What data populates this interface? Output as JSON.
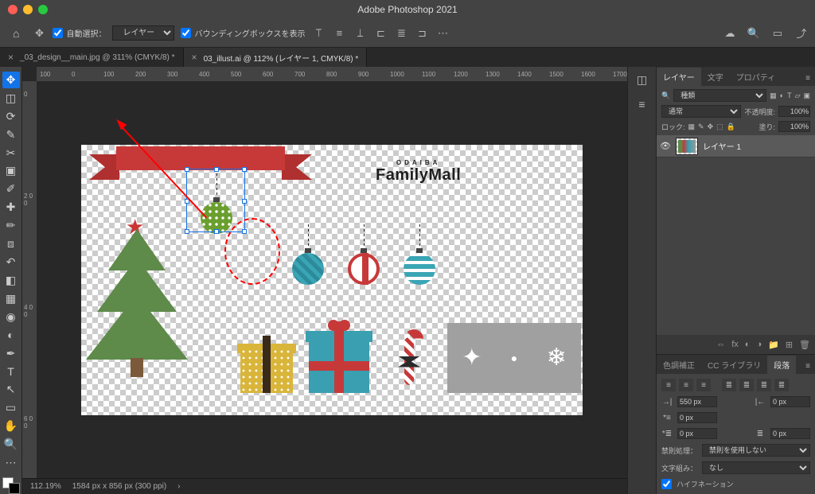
{
  "app_title": "Adobe Photoshop 2021",
  "options": {
    "auto_select_label": "自動選択：",
    "auto_select_value": "レイヤー",
    "bounding_label": "バウンディングボックスを表示"
  },
  "tabs": [
    {
      "label": "_03_design__main.jpg @ 311% (CMYK/8) *",
      "active": false
    },
    {
      "label": "03_illust.ai @ 112% (レイヤー 1, CMYK/8) *",
      "active": true
    }
  ],
  "ruler_h": [
    "100",
    "0",
    "100",
    "200",
    "300",
    "400",
    "500",
    "600",
    "700",
    "800",
    "900",
    "1000",
    "1100",
    "1200",
    "1300",
    "1400",
    "1500",
    "1600",
    "1700"
  ],
  "ruler_v": [
    "0",
    "2 0 0",
    "4 0 0",
    "6 0 0"
  ],
  "logo": {
    "small": "ODAIBA",
    "big": "FamilyMall"
  },
  "status": {
    "zoom": "112.19%",
    "dims": "1584 px x 856 px (300 ppi)"
  },
  "panels": {
    "layers_tabs": [
      "レイヤー",
      "文字",
      "プロパティ"
    ],
    "kind_label": "種類",
    "blend_mode": "通常",
    "opacity_label": "不透明度:",
    "opacity": "100%",
    "lock_label": "ロック:",
    "fill_label": "塗り:",
    "fill": "100%",
    "layer1": "レイヤー 1",
    "para_tabs": [
      "色調補正",
      "CC ライブラリ",
      "段落"
    ],
    "indent_left": "550 px",
    "indent_right": "0 px",
    "indent_first": "0 px",
    "space_before": "0 px",
    "space_after": "0 px",
    "kinsoku_label": "禁則処理：",
    "kinsoku_value": "禁則を使用しない",
    "mojikumi_label": "文字組み：",
    "mojikumi_value": "なし",
    "hyphen_label": "ハイフネーション"
  }
}
